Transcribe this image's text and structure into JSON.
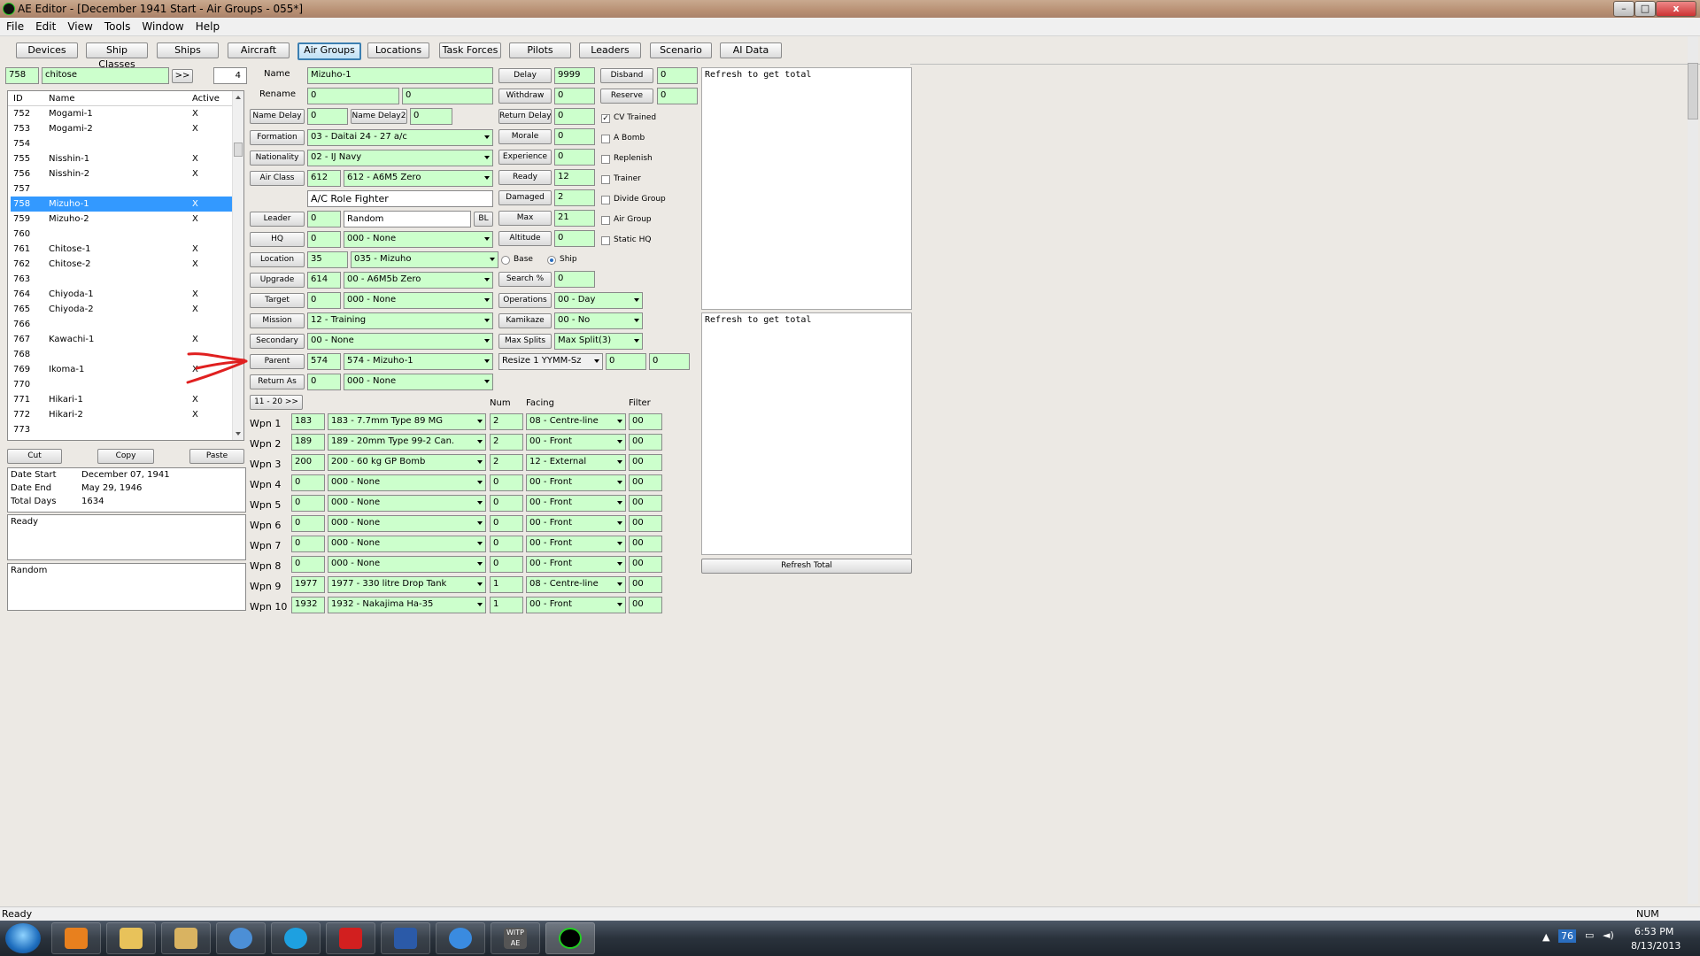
{
  "window": {
    "title": "AE Editor - [December 1941 Start - Air Groups - 055*]",
    "min": "–",
    "max": "□",
    "close": "x"
  },
  "menu": [
    "File",
    "Edit",
    "View",
    "Tools",
    "Window",
    "Help"
  ],
  "tabs": [
    "Devices",
    "Ship Classes",
    "Ships",
    "Aircraft",
    "Air Groups",
    "Locations",
    "Task Forces",
    "Pilots",
    "Leaders",
    "Scenario",
    "AI Data"
  ],
  "active_tab": "Air Groups",
  "search": {
    "id": "758",
    "text": "chitose",
    "go": ">>",
    "count": "4"
  },
  "list": {
    "headers": {
      "id": "ID",
      "name": "Name",
      "active": "Active"
    },
    "rows": [
      {
        "id": "752",
        "name": "Mogami-1",
        "active": "X"
      },
      {
        "id": "753",
        "name": "Mogami-2",
        "active": "X"
      },
      {
        "id": "754",
        "name": "",
        "active": ""
      },
      {
        "id": "755",
        "name": "Nisshin-1",
        "active": "X"
      },
      {
        "id": "756",
        "name": "Nisshin-2",
        "active": "X"
      },
      {
        "id": "757",
        "name": "",
        "active": ""
      },
      {
        "id": "758",
        "name": "Mizuho-1",
        "active": "X"
      },
      {
        "id": "759",
        "name": "Mizuho-2",
        "active": "X"
      },
      {
        "id": "760",
        "name": "",
        "active": ""
      },
      {
        "id": "761",
        "name": "Chitose-1",
        "active": "X"
      },
      {
        "id": "762",
        "name": "Chitose-2",
        "active": "X"
      },
      {
        "id": "763",
        "name": "",
        "active": ""
      },
      {
        "id": "764",
        "name": "Chiyoda-1",
        "active": "X"
      },
      {
        "id": "765",
        "name": "Chiyoda-2",
        "active": "X"
      },
      {
        "id": "766",
        "name": "",
        "active": ""
      },
      {
        "id": "767",
        "name": "Kawachi-1",
        "active": "X"
      },
      {
        "id": "768",
        "name": "",
        "active": ""
      },
      {
        "id": "769",
        "name": "Ikoma-1",
        "active": "X"
      },
      {
        "id": "770",
        "name": "",
        "active": ""
      },
      {
        "id": "771",
        "name": "Hikari-1",
        "active": "X"
      },
      {
        "id": "772",
        "name": "Hikari-2",
        "active": "X"
      },
      {
        "id": "773",
        "name": "",
        "active": ""
      }
    ],
    "selected_id": "758"
  },
  "clip": {
    "cut": "Cut",
    "copy": "Copy",
    "paste": "Paste"
  },
  "dates": {
    "start_label": "Date Start",
    "start": "December 07, 1941",
    "end_label": "Date End",
    "end": "May 29, 1946",
    "total_label": "Total Days",
    "total": "1634"
  },
  "panels": {
    "ready": "Ready",
    "random": "Random"
  },
  "form": {
    "name_label": "Name",
    "name": "Mizuho-1",
    "rename_label": "Rename",
    "rename1": "0",
    "rename2": "0",
    "namedelay_btn": "Name Delay",
    "namedelay": "0",
    "namedelay2_btn": "Name Delay2",
    "namedelay2": "0",
    "formation_btn": "Formation",
    "formation": "03 - Daitai 24 - 27 a/c",
    "nationality_btn": "Nationality",
    "nationality": "02 - IJ Navy",
    "airclass_btn": "Air Class",
    "airclass_id": "612",
    "airclass": "612 - A6M5 Zero",
    "role": "A/C Role  Fighter",
    "leader_btn": "Leader",
    "leader_id": "0",
    "leader": "Random",
    "bl": "BL",
    "hq_btn": "HQ",
    "hq_id": "0",
    "hq": "000 - None",
    "location_btn": "Location",
    "location_id": "35",
    "location": "035 - Mizuho",
    "base_label": "Base",
    "ship_label": "Ship",
    "upgrade_btn": "Upgrade",
    "upgrade_id": "614",
    "upgrade": "00 - A6M5b Zero",
    "target_btn": "Target",
    "target_id": "0",
    "target": "000 - None",
    "mission_btn": "Mission",
    "mission": "12 - Training",
    "secondary_btn": "Secondary",
    "secondary": "00 - None",
    "parent_btn": "Parent",
    "parent_id": "574",
    "parent": "574 - Mizuho-1",
    "returnas_btn": "Return As",
    "returnas_id": "0",
    "returnas": "000 - None",
    "page_btn": "11 - 20 >>"
  },
  "mid": {
    "delay_btn": "Delay",
    "delay": "9999",
    "withdraw_btn": "Withdraw",
    "withdraw": "0",
    "returndelay_btn": "Return Delay",
    "returndelay": "0",
    "morale_btn": "Morale",
    "morale": "0",
    "experience_btn": "Experience",
    "experience": "0",
    "ready_btn": "Ready",
    "ready": "12",
    "damaged_btn": "Damaged",
    "damaged": "2",
    "max_btn": "Max",
    "max": "21",
    "altitude_btn": "Altitude",
    "altitude": "0",
    "search_btn": "Search %",
    "search": "0",
    "operations_btn": "Operations",
    "operations": "00 - Day",
    "kamikaze_btn": "Kamikaze",
    "kamikaze": "00 - No",
    "maxsplits_btn": "Max Splits",
    "maxsplits": "Max Split(3)",
    "resize": "Resize 1 YYMM-Sz",
    "resize_a": "0",
    "resize_b": "0",
    "disband_btn": "Disband",
    "disband": "0",
    "reserve_btn": "Reserve",
    "reserve": "0"
  },
  "checks": [
    {
      "label": "CV Trained",
      "checked": true
    },
    {
      "label": "A Bomb",
      "checked": false
    },
    {
      "label": "Replenish",
      "checked": false
    },
    {
      "label": "Trainer",
      "checked": false
    },
    {
      "label": "Divide Group",
      "checked": false
    },
    {
      "label": "Air Group",
      "checked": false
    },
    {
      "label": "Static HQ",
      "checked": false
    }
  ],
  "weapons": {
    "headers": {
      "num": "Num",
      "facing": "Facing",
      "filter": "Filter"
    },
    "rows": [
      {
        "label": "Wpn 1",
        "id": "183",
        "name": "183 - 7.7mm Type 89 MG",
        "num": "2",
        "facing": "08 - Centre-line",
        "filter": "00"
      },
      {
        "label": "Wpn 2",
        "id": "189",
        "name": "189 - 20mm Type 99-2 Can.",
        "num": "2",
        "facing": "00 - Front",
        "filter": "00"
      },
      {
        "label": "Wpn 3",
        "id": "200",
        "name": "200 - 60 kg GP Bomb",
        "num": "2",
        "facing": "12 - External",
        "filter": "00"
      },
      {
        "label": "Wpn 4",
        "id": "0",
        "name": "000 - None",
        "num": "0",
        "facing": "00 - Front",
        "filter": "00"
      },
      {
        "label": "Wpn 5",
        "id": "0",
        "name": "000 - None",
        "num": "0",
        "facing": "00 - Front",
        "filter": "00"
      },
      {
        "label": "Wpn 6",
        "id": "0",
        "name": "000 - None",
        "num": "0",
        "facing": "00 - Front",
        "filter": "00"
      },
      {
        "label": "Wpn 7",
        "id": "0",
        "name": "000 - None",
        "num": "0",
        "facing": "00 - Front",
        "filter": "00"
      },
      {
        "label": "Wpn 8",
        "id": "0",
        "name": "000 - None",
        "num": "0",
        "facing": "00 - Front",
        "filter": "00"
      },
      {
        "label": "Wpn 9",
        "id": "1977",
        "name": "1977 - 330 litre Drop Tank",
        "num": "1",
        "facing": "08 - Centre-line",
        "filter": "00"
      },
      {
        "label": "Wpn 10",
        "id": "1932",
        "name": "1932 - Nakajima Ha-35",
        "num": "1",
        "facing": "00 - Front",
        "filter": "00"
      }
    ]
  },
  "totals": {
    "top": "Refresh to get total",
    "bottom": "Refresh to get total",
    "refresh_btn": "Refresh Total"
  },
  "status": {
    "left": "Ready",
    "right": "NUM"
  },
  "taskbar": {
    "icons": [
      "windows-start-icon",
      "media-player-icon",
      "explorer-icon",
      "folder-icon",
      "safari-icon",
      "skype-icon",
      "acrobat-icon",
      "word-icon",
      "itunes-icon",
      "witp-ae-icon",
      "ae-editor-icon"
    ],
    "witp_label": "WITP AE",
    "temp": "76",
    "time": "6:53 PM",
    "date": "8/13/2013"
  },
  "colors": {
    "field": "#ccffcc",
    "selection": "#3399ff",
    "annotation": "#e02020"
  }
}
